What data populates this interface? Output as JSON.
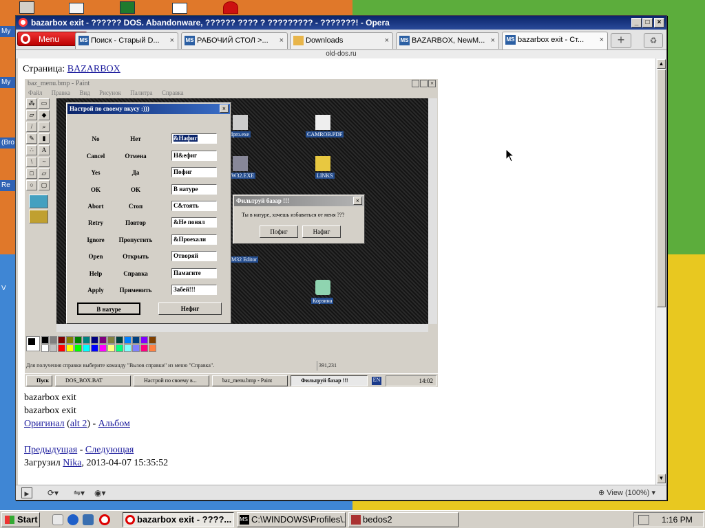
{
  "desktop": {
    "icon_labels": [
      "My",
      "My",
      "(Bro",
      "Re",
      "V"
    ]
  },
  "window": {
    "title": "bazarbox exit - ?????? DOS. Abandonware, ?????? ???? ? ????????? - ???????! - Opera",
    "min": "_",
    "max": "□",
    "close": "×"
  },
  "browser": {
    "menu_label": "Menu",
    "tabs": [
      {
        "icon": "MS",
        "label": "Поиск - Старый D..."
      },
      {
        "icon": "MS",
        "label": "РАБОЧИЙ СТОЛ >..."
      },
      {
        "icon": "",
        "label": "Downloads"
      },
      {
        "icon": "MS",
        "label": "BAZARBOX, NewM..."
      },
      {
        "icon": "MS",
        "label": "bazarbox exit - Ст..."
      }
    ],
    "tab_close": "×",
    "add_tab": "+",
    "url": "old-dos.ru",
    "status_zoom": "View (100%)"
  },
  "page": {
    "page_label": "Страница:",
    "page_link": "BAZARBOX",
    "caption1": "bazarbox exit",
    "caption2": "bazarbox exit",
    "original": "Оригинал",
    "lparen": "(",
    "alt2": "alt 2",
    "rparen": ")",
    "dash": " - ",
    "album": "Альбом",
    "prev": "Предыдущая",
    "next": "Следующая",
    "uploaded": "Загрузил",
    "user": "Nika",
    "date": ", 2013-04-07 15:35:52"
  },
  "screenshot": {
    "paint_title": "baz_menu.bmp - Paint",
    "paint_menu": [
      "Файл",
      "Правка",
      "Вид",
      "Рисунок",
      "Палитра",
      "Справка"
    ],
    "canvas_icons": [
      {
        "label": "dpro.exe"
      },
      {
        "label": "CAMROB.PDF"
      },
      {
        "label": "W32.EXE"
      },
      {
        "label": "LINKS"
      },
      {
        "label": "M32 Editor"
      },
      {
        "label": "Корзина"
      }
    ],
    "dialog1": {
      "title": "Настрой по своему вкусу :)))",
      "rows": [
        {
          "en": "No",
          "ru": "Нет",
          "val": "&Нафиг"
        },
        {
          "en": "Cancel",
          "ru": "Отмена",
          "val": "Н&ефиг"
        },
        {
          "en": "Yes",
          "ru": "Да",
          "val": "Пофиг"
        },
        {
          "en": "OK",
          "ru": "OK",
          "val": "В натуре"
        },
        {
          "en": "Abort",
          "ru": "Стоп",
          "val": "С&тоять"
        },
        {
          "en": "Retry",
          "ru": "Повтор",
          "val": "&Не понял"
        },
        {
          "en": "Ignore",
          "ru": "Пропустить",
          "val": "&Проехали"
        },
        {
          "en": "Open",
          "ru": "Открыть",
          "val": "Отворяй"
        },
        {
          "en": "Help",
          "ru": "Справка",
          "val": "Памагите"
        },
        {
          "en": "Apply",
          "ru": "Применить",
          "val": "Забей!!!"
        }
      ],
      "btn_ok": "В натуре",
      "btn_cancel": "Нефиг"
    },
    "dialog2": {
      "title": "Фильтруй базар !!!",
      "text": "Ты в натуре, хочешь избавиться от меня ???",
      "btn1": "Пофиг",
      "btn2": "Нафиг"
    },
    "status_text": "Для получения справки выберите команду \"Вызов справки\" из меню \"Справка\".",
    "status_coords": "391,231",
    "taskbar": {
      "start": "Пуск",
      "items": [
        "DOS_BOX.BAT",
        "Настрой по своему в...",
        "baz_menu.bmp - Paint",
        "Фильтруй базар !!!"
      ],
      "lang": "EN",
      "time": "14:02"
    },
    "palette_colors": [
      "#000000",
      "#808080",
      "#800000",
      "#808000",
      "#008000",
      "#008080",
      "#000080",
      "#800080",
      "#808040",
      "#004040",
      "#0080ff",
      "#004080",
      "#8000ff",
      "#804000",
      "#ffffff",
      "#c0c0c0",
      "#ff0000",
      "#ffff00",
      "#00ff00",
      "#00ffff",
      "#0000ff",
      "#ff00ff",
      "#ffff80",
      "#00ff80",
      "#80ffff",
      "#8080ff",
      "#ff0080",
      "#ff8040"
    ]
  },
  "taskbar": {
    "start": "Start",
    "items": [
      {
        "label": "bazarbox exit - ????...",
        "icon": "opera"
      },
      {
        "label": "C:\\WINDOWS\\Profiles\\...",
        "icon": "dos"
      },
      {
        "label": "bedos2",
        "icon": "app"
      }
    ],
    "time": "1:16 PM"
  },
  "colors": {
    "title_bar": "#0a246a",
    "link": "#1a1a9c",
    "opera_red": "#cc0000"
  }
}
